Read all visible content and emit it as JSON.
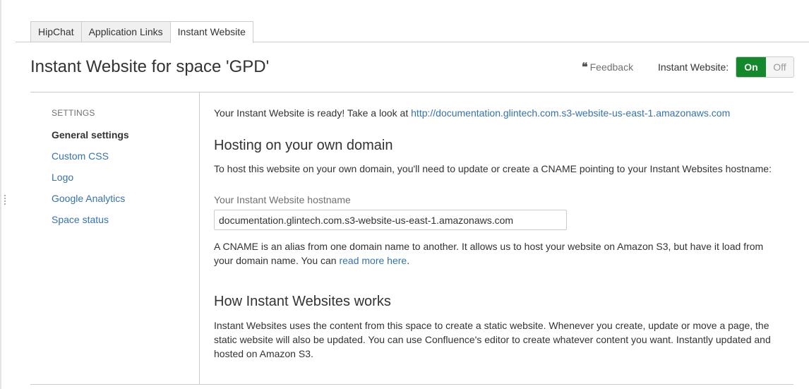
{
  "tabs": [
    {
      "label": "HipChat",
      "active": false
    },
    {
      "label": "Application Links",
      "active": false
    },
    {
      "label": "Instant Website",
      "active": true
    }
  ],
  "header": {
    "title": "Instant Website for space 'GPD'",
    "feedback_label": "Feedback",
    "feedback_icon": "quote-icon",
    "toggle_label": "Instant Website:",
    "toggle_on": "On",
    "toggle_off": "Off",
    "toggle_state": "on",
    "accent_color": "#14892c"
  },
  "sidebar": {
    "heading": "SETTINGS",
    "items": [
      {
        "label": "General settings",
        "active": true
      },
      {
        "label": "Custom CSS",
        "active": false
      },
      {
        "label": "Logo",
        "active": false
      },
      {
        "label": "Google Analytics",
        "active": false
      },
      {
        "label": "Space status",
        "active": false
      }
    ]
  },
  "main": {
    "ready_text": "Your Instant Website is ready! Take a look at",
    "ready_link": "http://documentation.glintech.com.s3-website-us-east-1.amazonaws.com",
    "hosting_heading": "Hosting on your own domain",
    "hosting_text": "To host this website on your own domain, you'll need to update or create a CNAME pointing to your Instant Websites hostname:",
    "hostname_label": "Your Instant Website hostname",
    "hostname_value": "documentation.glintech.com.s3-website-us-east-1.amazonaws.com",
    "cname_text": "A CNAME is an alias from one domain name to another. It allows us to host your website on Amazon S3, but have it load from your domain name. You can",
    "read_more_link": "read more here",
    "period": ".",
    "how_heading": "How Instant Websites works",
    "how_text": "Instant Websites uses the content from this space to create a static website. Whenever you create, update or move a page, the static website will also be updated. You can use Confluence's editor to create whatever content you want. Instantly updated and hosted on Amazon S3."
  }
}
